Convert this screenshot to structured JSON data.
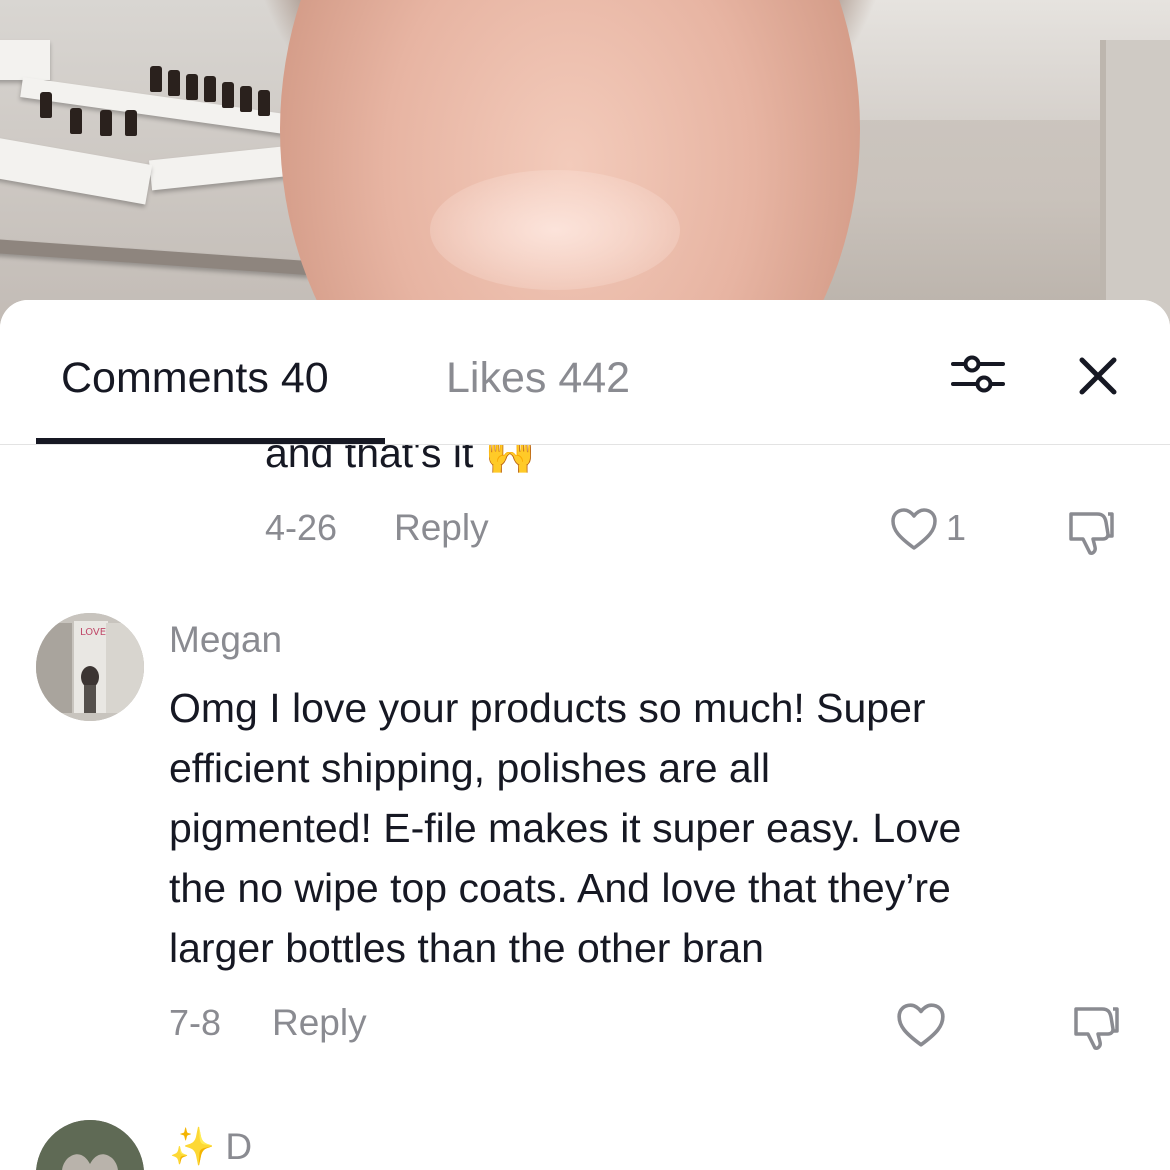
{
  "tabs": {
    "comments": "Comments 40",
    "likes": "Likes 442"
  },
  "comments": [
    {
      "text_visible": "and that's it",
      "emoji": "🙌",
      "date": "4-26",
      "reply_label": "Reply",
      "like_count": "1"
    },
    {
      "author": "Megan",
      "body_lines": [
        "Omg I love your products so much! Super",
        "efficient shipping, polishes are all",
        "pigmented! E-file makes it super easy. Love",
        "the no wipe top coats. And love that they’re",
        "larger bottles than the other bran"
      ],
      "date": "7-8",
      "reply_label": "Reply",
      "avatar_text": "YOU LOOK LOVELY"
    },
    {
      "author": "✨ D"
    }
  ],
  "icons": {
    "filter": "filter-icon",
    "close": "close-icon",
    "like": "heart-icon",
    "dislike": "thumbs-down-icon"
  },
  "colors": {
    "primary_text": "#161823",
    "secondary_text": "#8a8b91"
  }
}
